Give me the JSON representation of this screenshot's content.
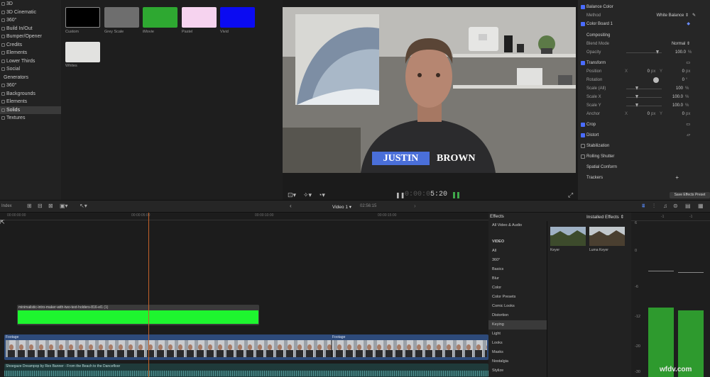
{
  "browser": {
    "items": [
      {
        "label": "3D",
        "icon": "folder-icon"
      },
      {
        "label": "3D Cinematic",
        "icon": "folder-icon"
      },
      {
        "label": "360°",
        "icon": "folder-icon"
      },
      {
        "label": "Build In/Out",
        "icon": "folder-icon"
      },
      {
        "label": "Bumper/Opener",
        "icon": "folder-icon"
      },
      {
        "label": "Credits",
        "icon": "folder-icon"
      },
      {
        "label": "Elements",
        "icon": "folder-icon"
      },
      {
        "label": "Lower Thirds",
        "icon": "folder-icon"
      },
      {
        "label": "Social",
        "icon": "folder-icon"
      },
      {
        "label": "Generators",
        "icon": ""
      },
      {
        "label": "360°",
        "icon": "folder-icon"
      },
      {
        "label": "Backgrounds",
        "icon": "folder-icon"
      },
      {
        "label": "Elements",
        "icon": "folder-icon"
      },
      {
        "label": "Solids",
        "icon": "folder-icon",
        "selected": true
      },
      {
        "label": "Textures",
        "icon": "folder-icon"
      }
    ]
  },
  "gallery": {
    "swatches": [
      {
        "label": "Custom",
        "color": "#000000"
      },
      {
        "label": "Grey Scale",
        "color": "#6e6e6e"
      },
      {
        "label": "iMovie",
        "color": "#2ea831"
      },
      {
        "label": "Pastel",
        "color": "#f6d3ef"
      },
      {
        "label": "Vivid",
        "color": "#0b0bf2"
      },
      {
        "label": "Whites",
        "color": "#e2e2e0"
      }
    ]
  },
  "viewer": {
    "lower_third_first": "JUSTIN",
    "lower_third_last": "BROWN",
    "timecode": "5:20",
    "accent": "#4a6fd9"
  },
  "inspector": {
    "balance_color": "Balance Color",
    "method_label": "Method",
    "method_value": "White Balance",
    "color_board": "Color Board 1",
    "compositing": "Compositing",
    "blend_mode_label": "Blend Mode",
    "blend_mode_value": "Normal",
    "opacity_label": "Opacity",
    "opacity_value": "100.0",
    "transform": "Transform",
    "position_label": "Position",
    "position_x": "0",
    "position_y": "0",
    "rotation_label": "Rotation",
    "rotation_value": "0",
    "scale_all_label": "Scale (All)",
    "scale_all_value": "100",
    "scale_x_label": "Scale X",
    "scale_x_value": "100.0",
    "scale_y_label": "Scale Y",
    "scale_y_value": "100.0",
    "anchor_label": "Anchor",
    "anchor_x": "0",
    "anchor_y": "0",
    "crop": "Crop",
    "distort": "Distort",
    "stabilization": "Stabilization",
    "rolling_shutter": "Rolling Shutter",
    "spatial_conform": "Spatial Conform",
    "trackers": "Trackers",
    "save_preset": "Save Effects Preset",
    "unit_px": "px",
    "unit_pct": "%",
    "unit_deg": "°",
    "axis_x": "X",
    "axis_y": "Y"
  },
  "toolbar": {
    "index": "Index",
    "project": "Video 1",
    "duration": "02:56:15"
  },
  "timeline": {
    "ruler": [
      "00:00:00:00",
      "00:00:05:00",
      "00:00:10:00",
      "00:00:15:00"
    ],
    "green_clip": "minimalistic-intro-maker-with-two-text-holders-816-el1 (1)",
    "footage_a": "Footage",
    "footage_b": "Footage",
    "audio_clip": "Shoegaze Dreampop by Rex Banner - From the Beach to the Dancefloor"
  },
  "effects": {
    "title": "Effects",
    "installed": "Installed Effects",
    "categories": [
      "All Video & Audio",
      "VIDEO",
      "All",
      "360°",
      "Basics",
      "Blur",
      "Color",
      "Color Presets",
      "Comic Looks",
      "Distortion",
      "Keying",
      "Light",
      "Looks",
      "Masks",
      "Nostalgia",
      "Stylize"
    ],
    "selected": "Keying",
    "thumbs": [
      {
        "label": "Keyer"
      },
      {
        "label": "Luma Keyer"
      }
    ]
  },
  "meters": {
    "labels": [
      "6",
      "0",
      "-6",
      "-12",
      "-20",
      "-30"
    ],
    "channel_labels": [
      "-1",
      "-1"
    ],
    "watermark": "wfdv.com"
  }
}
